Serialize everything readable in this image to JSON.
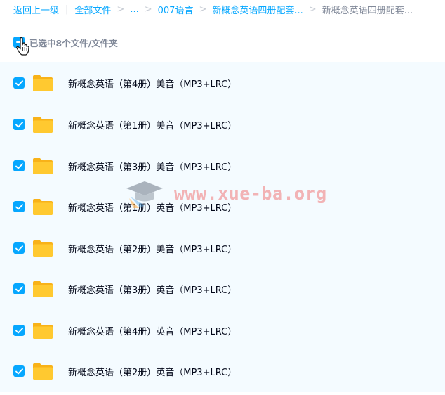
{
  "breadcrumb": {
    "back": "返回上一级",
    "all_files": "全部文件",
    "ellipsis": "...",
    "folder_007": "007语言",
    "folder_parent": "新概念英语四册配套...",
    "current": "新概念英语四册配套..."
  },
  "selection": {
    "summary": "已选中8个文件/文件夹"
  },
  "files": [
    {
      "name": "新概念英语（第4册）美音（MP3+LRC）",
      "checked": true,
      "icon": "folder-icon"
    },
    {
      "name": "新概念英语（第1册）美音（MP3+LRC）",
      "checked": true,
      "icon": "folder-icon"
    },
    {
      "name": "新概念英语（第3册）美音（MP3+LRC）",
      "checked": true,
      "icon": "folder-icon"
    },
    {
      "name": "新概念英语（第1册）英音（MP3+LRC）",
      "checked": true,
      "icon": "folder-icon"
    },
    {
      "name": "新概念英语（第2册）美音（MP3+LRC）",
      "checked": true,
      "icon": "folder-icon"
    },
    {
      "name": "新概念英语（第3册）英音（MP3+LRC）",
      "checked": true,
      "icon": "folder-icon"
    },
    {
      "name": "新概念英语（第4册）英音（MP3+LRC）",
      "checked": true,
      "icon": "folder-icon"
    },
    {
      "name": "新概念英语（第2册）英音（MP3+LRC）",
      "checked": true,
      "icon": "folder-icon"
    }
  ],
  "watermark": {
    "text": "www.xue-ba.org"
  },
  "colors": {
    "accent": "#06a7ff",
    "list_background": "#f4fbff",
    "folder_yellow": "#ffc42e"
  }
}
